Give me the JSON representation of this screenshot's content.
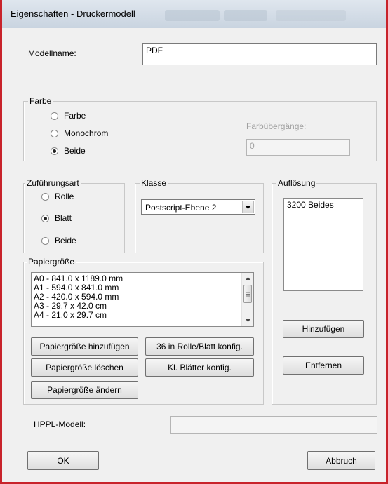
{
  "window": {
    "title": "Eigenschaften - Druckermodell"
  },
  "modellname": {
    "label": "Modellname:",
    "value": "PDF"
  },
  "farbe": {
    "title": "Farbe",
    "options": [
      "Farbe",
      "Monochrom",
      "Beide"
    ],
    "selected": "Beide",
    "farbuebergaenge_label": "Farbübergänge:",
    "farbuebergaenge_value": "0"
  },
  "zufuehrungsart": {
    "title": "Zuführungsart",
    "options": [
      "Rolle",
      "Blatt",
      "Beide"
    ],
    "selected": "Blatt"
  },
  "klasse": {
    "title": "Klasse",
    "selected": "Postscript-Ebene 2"
  },
  "aufloesung": {
    "title": "Auflösung",
    "items": [
      "3200 Beides"
    ],
    "add_button": "Hinzufügen",
    "remove_button": "Entfernen"
  },
  "papiergroesse": {
    "title": "Papiergröße",
    "items": [
      "A0 - 841.0 x 1189.0 mm",
      "A1 - 594.0 x 841.0 mm",
      "A2 - 420.0 x 594.0 mm",
      "A3 - 29.7 x 42.0 cm",
      "A4 - 21.0 x 29.7 cm"
    ],
    "btn_add": "Papiergröße hinzufügen",
    "btn_delete": "Papiergröße löschen",
    "btn_change": "Papiergröße ändern",
    "btn_roll": "36 in Rolle/Blatt konfig.",
    "btn_small": "Kl. Blätter konfig."
  },
  "hppl": {
    "label": "HPPL-Modell:",
    "value": ""
  },
  "footer": {
    "ok": "OK",
    "cancel": "Abbruch"
  }
}
